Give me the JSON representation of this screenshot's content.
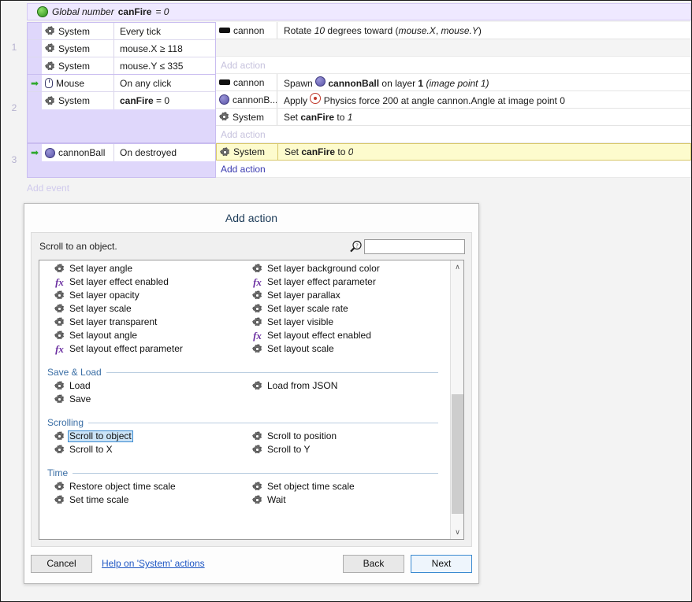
{
  "event_sheet": {
    "global_variable": {
      "icon": "globe-icon",
      "prefix": "Global number",
      "name": "canFire",
      "equals": "= 0"
    },
    "add_event_label": "Add event",
    "events": [
      {
        "number": "1",
        "conditions": [
          {
            "icon": "gear-icon",
            "object": "System",
            "text": "Every tick",
            "arrow": false
          },
          {
            "icon": "gear-icon",
            "object": "System",
            "text": "mouse.X ≥ 118",
            "arrow": false
          },
          {
            "icon": "gear-icon",
            "object": "System",
            "text": "mouse.Y ≤ 335",
            "arrow": false
          }
        ],
        "actions": [
          {
            "icon": "cannon-icon",
            "object": "cannon",
            "text": "Rotate 10 degrees toward (mouse.X, mouse.Y)",
            "selected": false
          }
        ],
        "add_action_label": "Add action",
        "add_action_is_link": false
      },
      {
        "number": "2",
        "conditions": [
          {
            "icon": "mouse-icon",
            "object": "Mouse",
            "text": "On any click",
            "arrow": true
          },
          {
            "icon": "gear-icon",
            "object": "System",
            "text": "canFire = 0",
            "arrow": false
          }
        ],
        "actions": [
          {
            "icon": "cannon-icon",
            "object": "cannon",
            "text": "Spawn cannonBall on layer 1 (image point 1)",
            "selected": false
          },
          {
            "icon": "ball-icon",
            "object": "cannonB...",
            "text": "Apply Physics force 200 at angle cannon.Angle at image point 0",
            "selected": false
          },
          {
            "icon": "gear-icon",
            "object": "System",
            "text": "Set canFire to 1",
            "selected": false
          }
        ],
        "add_action_label": "Add action",
        "add_action_is_link": false
      },
      {
        "number": "3",
        "conditions": [
          {
            "icon": "ball-icon",
            "object": "cannonBall",
            "text": "On destroyed",
            "arrow": true
          }
        ],
        "actions": [
          {
            "icon": "gear-icon",
            "object": "System",
            "text": "Set canFire to 0",
            "selected": true
          }
        ],
        "add_action_label": "Add action",
        "add_action_is_link": true
      }
    ]
  },
  "dialog": {
    "title": "Add action",
    "description": "Scroll to an object.",
    "search": {
      "icon": "search-help-icon",
      "value": "",
      "placeholder": ""
    },
    "selected_item": "Scroll to object",
    "sections": [
      {
        "title": "",
        "show_rule": false,
        "items": [
          {
            "label": "Set layer angle",
            "icon": "gear-icon"
          },
          {
            "label": "Set layer background color",
            "icon": "gear-icon"
          },
          {
            "label": "Set layer effect enabled",
            "icon": "fx-icon"
          },
          {
            "label": "Set layer effect parameter",
            "icon": "fx-icon"
          },
          {
            "label": "Set layer opacity",
            "icon": "gear-icon"
          },
          {
            "label": "Set layer parallax",
            "icon": "gear-icon"
          },
          {
            "label": "Set layer scale",
            "icon": "gear-icon"
          },
          {
            "label": "Set layer scale rate",
            "icon": "gear-icon"
          },
          {
            "label": "Set layer transparent",
            "icon": "gear-icon"
          },
          {
            "label": "Set layer visible",
            "icon": "gear-icon"
          },
          {
            "label": "Set layout angle",
            "icon": "gear-icon"
          },
          {
            "label": "Set layout effect enabled",
            "icon": "fx-icon"
          },
          {
            "label": "Set layout effect parameter",
            "icon": "fx-icon"
          },
          {
            "label": "Set layout scale",
            "icon": "gear-icon"
          }
        ]
      },
      {
        "title": "Save & Load",
        "show_rule": true,
        "items": [
          {
            "label": "Load",
            "icon": "gear-icon"
          },
          {
            "label": "Load from JSON",
            "icon": "gear-icon"
          },
          {
            "label": "Save",
            "icon": "gear-icon"
          },
          {
            "label": "",
            "icon": ""
          }
        ]
      },
      {
        "title": "Scrolling",
        "show_rule": true,
        "items": [
          {
            "label": "Scroll to object",
            "icon": "gear-icon"
          },
          {
            "label": "Scroll to position",
            "icon": "gear-icon"
          },
          {
            "label": "Scroll to X",
            "icon": "gear-icon"
          },
          {
            "label": "Scroll to Y",
            "icon": "gear-icon"
          }
        ]
      },
      {
        "title": "Time",
        "show_rule": true,
        "items": [
          {
            "label": "Restore object time scale",
            "icon": "gear-icon"
          },
          {
            "label": "Set object time scale",
            "icon": "gear-icon"
          },
          {
            "label": "Set time scale",
            "icon": "gear-icon"
          },
          {
            "label": "Wait",
            "icon": "gear-icon"
          }
        ]
      }
    ],
    "scrollbar": {
      "up_glyph": "∧",
      "down_glyph": "∨",
      "thumb_top_pct": 46,
      "thumb_height_pct": 46
    },
    "footer": {
      "cancel_label": "Cancel",
      "help_label": "Help on 'System' actions",
      "back_label": "Back",
      "next_label": "Next"
    }
  },
  "colors": {
    "event_block": "#dfd7fb",
    "global_bar": "#efe9ff",
    "selected_action": "#fdfbcd",
    "selection_blue": "#cce4f7",
    "section_header": "#3a6ea5",
    "link": "#1f57c4"
  }
}
